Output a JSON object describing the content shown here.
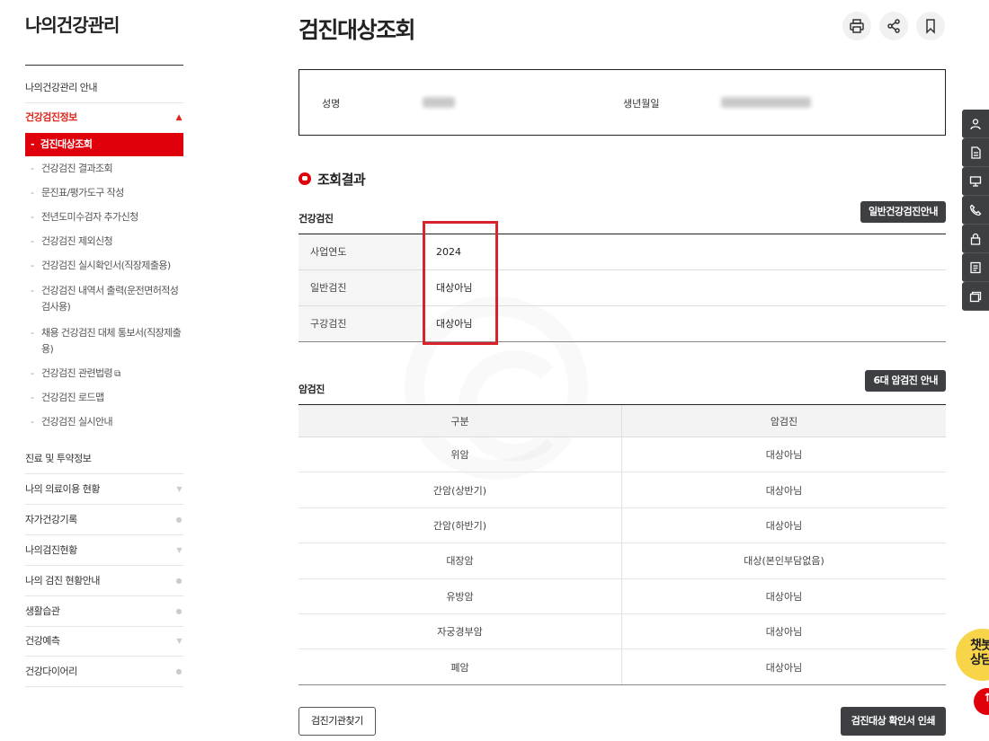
{
  "sidebar": {
    "title": "나의건강관리",
    "items": [
      {
        "label": "나의건강관리 안내"
      },
      {
        "label": "건강검진정보"
      },
      {
        "label": "진료 및 투약정보"
      },
      {
        "label": "나의 의료이용 현황"
      },
      {
        "label": "자가건강기록"
      },
      {
        "label": "나의검진현황"
      },
      {
        "label": "나의 검진 현황안내"
      },
      {
        "label": "생활습관"
      },
      {
        "label": "건강예측"
      },
      {
        "label": "건강다이어리"
      }
    ],
    "submenu_active": "검진대상조회",
    "submenu": [
      {
        "label": "건강검진 결과조회"
      },
      {
        "label": "문진표/평가도구 작성"
      },
      {
        "label": "전년도미수검자 추가신청"
      },
      {
        "label": "건강검진 제외신청"
      },
      {
        "label": "건강검진 실시확인서(직장제출용)"
      },
      {
        "label": "건강검진 내역서 출력(운전면허적성검사용)"
      },
      {
        "label": "채용 건강검진 대체 통보서(직장제출용)"
      },
      {
        "label": "건강검진 관련법령"
      },
      {
        "label": "건강검진 로드맵"
      },
      {
        "label": "건강검진 실시안내"
      }
    ]
  },
  "header": {
    "title": "검진대상조회",
    "icons": [
      "print-icon",
      "share-icon",
      "bookmark-icon"
    ]
  },
  "info": {
    "name_label": "성명",
    "birth_label": "생년월일"
  },
  "result": {
    "heading": "조회결과",
    "health_exam": {
      "title": "건강검진",
      "guide_button": "일반건강검진안내",
      "rows": [
        {
          "label": "사업연도",
          "value": "2024"
        },
        {
          "label": "일반검진",
          "value": "대상아님"
        },
        {
          "label": "구강검진",
          "value": "대상아님"
        }
      ]
    },
    "cancer_exam": {
      "title": "암검진",
      "guide_button": "6대 암검진 안내",
      "columns": [
        "구분",
        "암검진"
      ],
      "rows": [
        {
          "type": "위암",
          "status": "대상아님"
        },
        {
          "type": "간암(상반기)",
          "status": "대상아님"
        },
        {
          "type": "간암(하반기)",
          "status": "대상아님"
        },
        {
          "type": "대장암",
          "status": "대상(본인부담없음)"
        },
        {
          "type": "유방암",
          "status": "대상아님"
        },
        {
          "type": "자궁경부암",
          "status": "대상아님"
        },
        {
          "type": "폐암",
          "status": "대상아님"
        }
      ]
    }
  },
  "footer": {
    "find_institution_button": "검진기관찾기",
    "print_certificate_button": "검진대상 확인서 인쇄"
  },
  "quick_menu": {
    "icons": [
      "user-icon",
      "document-icon",
      "monitor-icon",
      "phone-icon",
      "lock-icon",
      "list-icon",
      "cards-icon"
    ],
    "chat_label": "챗봇\n상담",
    "top_label": "↑"
  },
  "colors": {
    "accent_red": "#e0000b",
    "dark_button": "#3d3f42",
    "highlight": "#d8222c"
  }
}
